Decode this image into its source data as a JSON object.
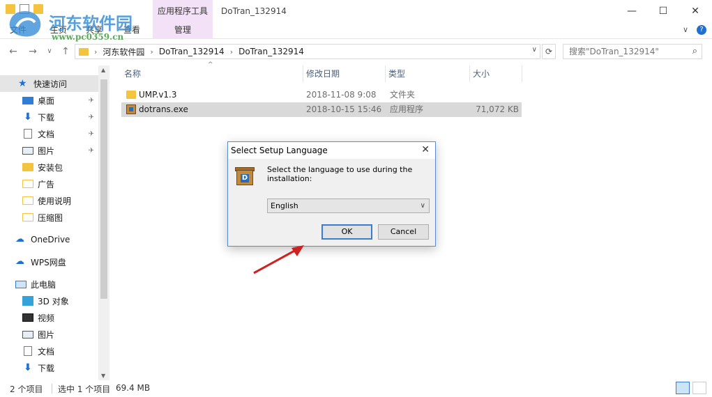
{
  "window": {
    "title": "DoTran_132914",
    "context_tab_title": "应用程序工具",
    "minimize": "—",
    "maximize": "☐",
    "close": "✕"
  },
  "watermark": {
    "title": "河东软件园",
    "url": "www.pc0359.cn"
  },
  "ribbon": {
    "tabs": [
      "文件",
      "主页",
      "共享",
      "查看"
    ],
    "context_tab": "管理",
    "collapse": "∨",
    "help": "?"
  },
  "nav": {
    "back": "←",
    "forward": "→",
    "recent": "∨",
    "up": "↑",
    "breadcrumb": [
      "河东软件园",
      "DoTran_132914",
      "DoTran_132914"
    ],
    "refresh": "⟳",
    "search_placeholder": "搜索\"DoTran_132914\""
  },
  "sidebar": {
    "items": [
      {
        "label": "快速访问",
        "icon": "star-icon"
      },
      {
        "label": "桌面",
        "icon": "desktop-icon",
        "pinned": true
      },
      {
        "label": "下载",
        "icon": "download-icon",
        "pinned": true
      },
      {
        "label": "文档",
        "icon": "document-icon",
        "pinned": true
      },
      {
        "label": "图片",
        "icon": "picture-icon",
        "pinned": true
      },
      {
        "label": "安装包",
        "icon": "folder-icon"
      },
      {
        "label": "广告",
        "icon": "folder-icon"
      },
      {
        "label": "使用说明",
        "icon": "folder-icon"
      },
      {
        "label": "压缩图",
        "icon": "folder-icon"
      },
      {
        "label": "OneDrive",
        "icon": "cloud-icon"
      },
      {
        "label": "WPS网盘",
        "icon": "cloud-icon"
      },
      {
        "label": "此电脑",
        "icon": "computer-icon"
      },
      {
        "label": "3D 对象",
        "icon": "cube-icon"
      },
      {
        "label": "视频",
        "icon": "video-icon"
      },
      {
        "label": "图片",
        "icon": "picture-icon"
      },
      {
        "label": "文档",
        "icon": "document-icon"
      },
      {
        "label": "下载",
        "icon": "download-icon"
      }
    ],
    "pin_glyph": "📌"
  },
  "filelist": {
    "columns": [
      "名称",
      "修改日期",
      "类型",
      "大小"
    ],
    "rows": [
      {
        "name": "UMP.v1.3",
        "date": "2018-11-08 9:08",
        "type": "文件夹",
        "size": "",
        "icon": "folder-icon"
      },
      {
        "name": "dotrans.exe",
        "date": "2018-10-15 15:46",
        "type": "应用程序",
        "size": "71,072 KB",
        "icon": "app-icon",
        "selected": true
      }
    ]
  },
  "dialog": {
    "title": "Select Setup Language",
    "close": "✕",
    "prompt": "Select the language to use during the installation:",
    "selected_language": "English",
    "ok_label": "OK",
    "cancel_label": "Cancel"
  },
  "status": {
    "item_count": "2 个项目",
    "selection": "选中 1 个项目",
    "size": "69.4 MB"
  },
  "colors": {
    "accent": "#1f6fd1",
    "context_tab_bg": "#f3e1f7",
    "selection_bg": "#d9d9d9",
    "arrow": "#d0201f"
  }
}
